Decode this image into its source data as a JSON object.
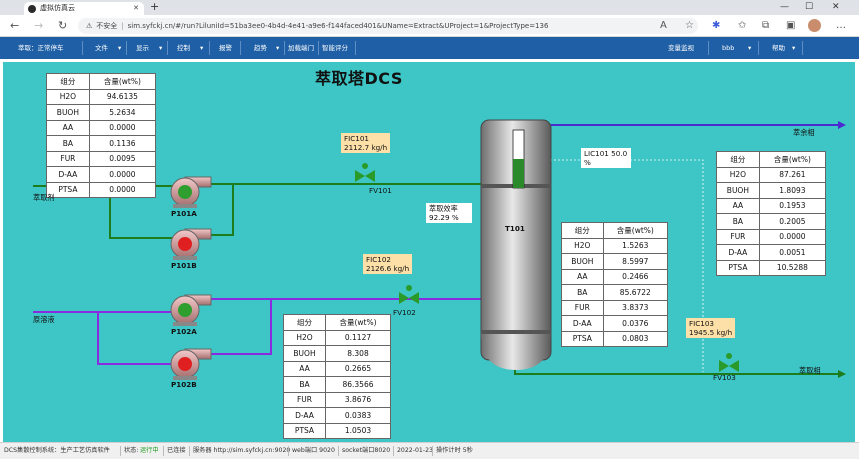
{
  "browser": {
    "tab_title": "虚拟仿真云",
    "security_label": "不安全",
    "url_host": "sim.syfckj.cn",
    "url_path": "/#/run?LiluniId=51ba3ee0-4b4d-4e41-a9e6-f144faced401&UName=Extract&UProject=1&ProjectType=136"
  },
  "menu": {
    "status": "萃取：正常停车",
    "items": [
      "文件",
      "显示",
      "控制",
      "报警",
      "趋势",
      "加载端门",
      "智能评分"
    ],
    "right_items": [
      "变量监视",
      "bbb",
      "帮助"
    ]
  },
  "scada": {
    "title": "萃取塔DCS",
    "col_component": "组分",
    "col_content": "含量(wt%)",
    "feed_table": [
      [
        "H2O",
        "94.6135"
      ],
      [
        "BUOH",
        "5.2634"
      ],
      [
        "AA",
        "0.0000"
      ],
      [
        "BA",
        "0.1136"
      ],
      [
        "FUR",
        "0.0095"
      ],
      [
        "D-AA",
        "0.0000"
      ],
      [
        "PTSA",
        "0.0000"
      ]
    ],
    "raw_table": [
      [
        "H2O",
        "0.1127"
      ],
      [
        "BUOH",
        "8.308"
      ],
      [
        "AA",
        "0.2665"
      ],
      [
        "BA",
        "86.3566"
      ],
      [
        "FUR",
        "3.8676"
      ],
      [
        "D-AA",
        "0.0383"
      ],
      [
        "PTSA",
        "1.0503"
      ]
    ],
    "extract_table": [
      [
        "H2O",
        "1.5263"
      ],
      [
        "BUOH",
        "8.5997"
      ],
      [
        "AA",
        "0.2466"
      ],
      [
        "BA",
        "85.6722"
      ],
      [
        "FUR",
        "3.8373"
      ],
      [
        "D-AA",
        "0.0376"
      ],
      [
        "PTSA",
        "0.0803"
      ]
    ],
    "raffinate_table": [
      [
        "H2O",
        "87.261"
      ],
      [
        "BUOH",
        "1.8093"
      ],
      [
        "AA",
        "0.1953"
      ],
      [
        "BA",
        "0.2005"
      ],
      [
        "FUR",
        "0.0000"
      ],
      [
        "D-AA",
        "0.0051"
      ],
      [
        "PTSA",
        "10.5288"
      ]
    ],
    "fic101": {
      "tag": "FIC101",
      "value": "2112.7",
      "unit": "kg/h"
    },
    "fic102": {
      "tag": "FIC102",
      "value": "2126.6",
      "unit": "kg/h"
    },
    "fic103": {
      "tag": "FIC103",
      "value": "1945.5",
      "unit": "kg/h"
    },
    "lic101": {
      "tag": "LIC101",
      "value": "50.0",
      "unit": "%"
    },
    "efficiency": {
      "label": "萃取效率",
      "value": "92.29",
      "unit": "%"
    },
    "level_fraction": 0.5,
    "valves": {
      "fv101": "FV101",
      "fv102": "FV102",
      "fv103": "FV103"
    },
    "pumps": {
      "p101a": "P101A",
      "p101b": "P101B",
      "p102a": "P102A",
      "p102b": "P102B"
    },
    "tower": "T101",
    "streams": {
      "solvent": "萃取剂",
      "feed": "原溶液",
      "raffinate": "萃余相",
      "extract": "萃取相"
    }
  },
  "statusbar": {
    "system": "DCS集散控制系统：生产工艺仿真软件",
    "state_label": "状态:",
    "state_value": "运行中",
    "connected": "已连接",
    "server": "服务器 http://sim.syfckj.cn:9020",
    "web_port": "web端口 9020",
    "socket_port": "socket端口8020",
    "date": "2022-01-23",
    "timer": "操作计时 5秒"
  },
  "colors": {
    "background": "#3ec6c6",
    "menu": "#1e5fa6",
    "pipe_green": "#1d7d1d",
    "pipe_purple": "#8a2be2",
    "pump_on": "#2e9e2e",
    "pump_off": "#e02020"
  }
}
